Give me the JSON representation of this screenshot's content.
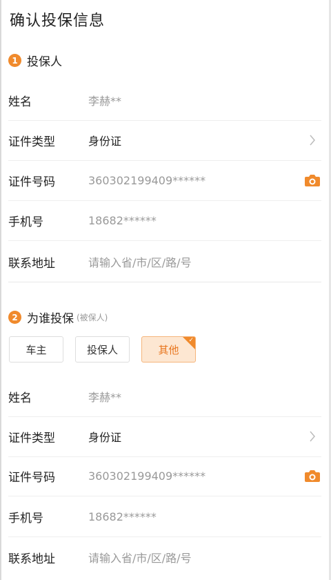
{
  "page": {
    "title": "确认投保信息"
  },
  "section1": {
    "step": "1",
    "title": "投保人",
    "fields": {
      "name": {
        "label": "姓名",
        "value": "李赫**"
      },
      "id_type": {
        "label": "证件类型",
        "value": "身份证"
      },
      "id_number": {
        "label": "证件号码",
        "value": "360302199409******"
      },
      "phone": {
        "label": "手机号",
        "value": "18682******"
      },
      "address": {
        "label": "联系地址",
        "placeholder": "请输入省/市/区/路/号"
      }
    }
  },
  "section2": {
    "step": "2",
    "title": "为谁投保",
    "note": "(被保人)",
    "options": {
      "owner": "车主",
      "policyholder": "投保人",
      "other": "其他"
    },
    "selected": "其他",
    "fields": {
      "name": {
        "label": "姓名",
        "value": "李赫**"
      },
      "id_type": {
        "label": "证件类型",
        "value": "身份证"
      },
      "id_number": {
        "label": "证件号码",
        "value": "360302199409******"
      },
      "phone": {
        "label": "手机号",
        "value": "18682******"
      },
      "address": {
        "label": "联系地址",
        "placeholder": "请输入省/市/区/路/号"
      }
    }
  },
  "colors": {
    "accent": "#f08a2c",
    "selected_bg": "#fde7d2",
    "muted_text": "#999999"
  },
  "icons": {
    "camera": "camera-icon",
    "chevron": "chevron-right-icon"
  }
}
